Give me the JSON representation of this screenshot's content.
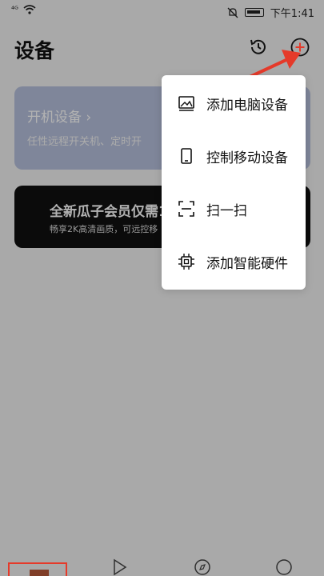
{
  "status_bar": {
    "signal": "⁴ᴳ",
    "time": "下午1:41"
  },
  "header": {
    "title": "设备"
  },
  "cards": {
    "power": {
      "title": "开机设备 ›",
      "subtitle": "任性远程开关机、定时开"
    },
    "vip": {
      "title": "全新瓜子会员仅需1",
      "subtitle": "畅享2K高清画质，可远控移"
    }
  },
  "menu": {
    "items": [
      {
        "label": "添加电脑设备",
        "icon": "image-icon"
      },
      {
        "label": "控制移动设备",
        "icon": "phone-icon"
      },
      {
        "label": "扫一扫",
        "icon": "scan-icon"
      },
      {
        "label": "添加智能硬件",
        "icon": "chip-icon"
      }
    ]
  },
  "colors": {
    "accent": "#e53a2a",
    "power_card": "#b7c1dd",
    "vip_card": "#111111"
  }
}
